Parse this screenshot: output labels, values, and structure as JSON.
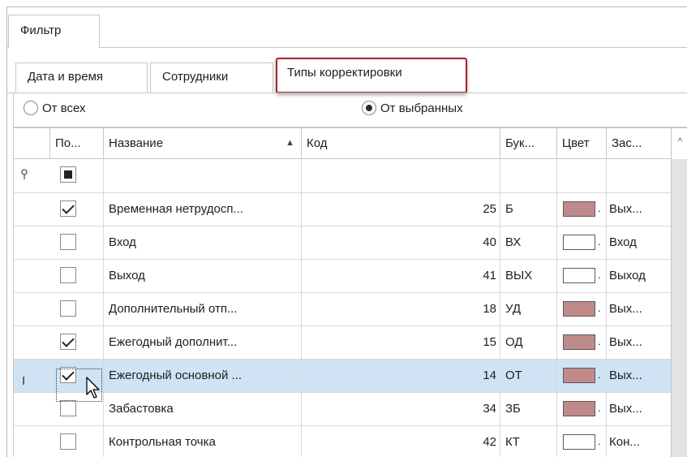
{
  "tabs": {
    "filter": "Фильтр"
  },
  "subtabs": {
    "datetime": "Дата и время",
    "employees": "Сотрудники",
    "types": "Типы корректировки"
  },
  "radios": {
    "all": "От всех",
    "selected": "От выбранных",
    "selected_value": "selected"
  },
  "columns": [
    "По...",
    "Название",
    "Код",
    "Бук...",
    "Цвет",
    "Зас..."
  ],
  "sort": {
    "column": "Название",
    "direction": "asc"
  },
  "filter_row": {
    "checkbox_state": "indeterminate",
    "indicator_icon": "filter-pin-icon"
  },
  "colors": {
    "brown": "#c08a8a",
    "white": "#ffffff",
    "selected_row": "#cfe3f4",
    "highlight_border": "#b01e2a"
  },
  "rows": [
    {
      "checked": true,
      "name": "Временная нетрудосп...",
      "code": "25",
      "letter": "Б",
      "color": "#c08a8a",
      "fill": "Вых..."
    },
    {
      "checked": false,
      "name": "Вход",
      "code": "40",
      "letter": "ВХ",
      "color": "#ffffff",
      "fill": "Вход"
    },
    {
      "checked": false,
      "name": "Выход",
      "code": "41",
      "letter": "ВЫХ",
      "color": "#ffffff",
      "fill": "Выход"
    },
    {
      "checked": false,
      "name": "Дополнительный отп...",
      "code": "18",
      "letter": "УД",
      "color": "#c08a8a",
      "fill": "Вых..."
    },
    {
      "checked": true,
      "name": "Ежегодный дополнит...",
      "code": "15",
      "letter": "ОД",
      "color": "#c08a8a",
      "fill": "Вых..."
    },
    {
      "checked": true,
      "name": "Ежегодный основной ...",
      "code": "14",
      "letter": "ОТ",
      "color": "#c08a8a",
      "fill": "Вых...",
      "selected": true
    },
    {
      "checked": false,
      "name": "Забастовка",
      "code": "34",
      "letter": "ЗБ",
      "color": "#c08a8a",
      "fill": "Вых..."
    },
    {
      "checked": false,
      "name": "Контрольная точка",
      "code": "42",
      "letter": "КТ",
      "color": "#ffffff",
      "fill": "Кон..."
    }
  ]
}
